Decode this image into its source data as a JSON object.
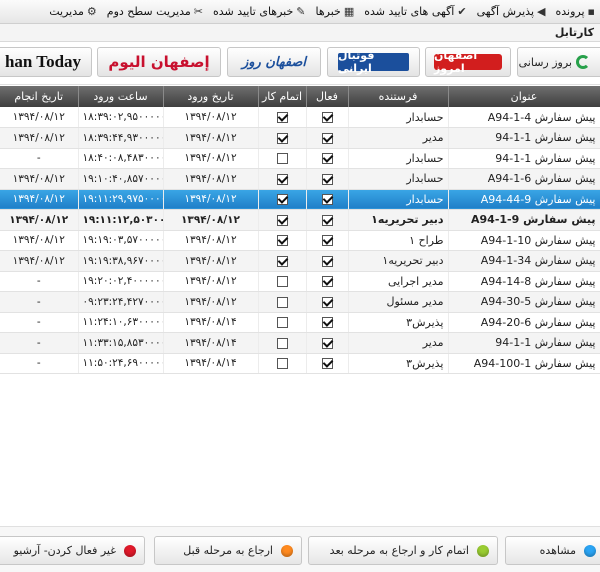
{
  "menu": [
    {
      "label": "پرونده",
      "icon": "folder-icon",
      "glyph": "▪"
    },
    {
      "label": "پذیرش آگهی",
      "icon": "megaphone-icon",
      "glyph": "◀"
    },
    {
      "label": "آگهی های تایید شده",
      "icon": "check-icon",
      "glyph": "✔"
    },
    {
      "label": "خبرها",
      "icon": "news-icon",
      "glyph": "▦"
    },
    {
      "label": "خبرهای تایید شده",
      "icon": "approved-news-icon",
      "glyph": "✎"
    },
    {
      "label": "مدیریت سطح دوم",
      "icon": "tools-icon",
      "glyph": "✂"
    },
    {
      "label": "مدیریت",
      "icon": "gear-icon",
      "glyph": "⚙"
    }
  ],
  "page_title": "کارتابل",
  "toolbar": {
    "refresh_label": "بروز رسانی",
    "logos": [
      {
        "name": "logo-esfahan-emrooz",
        "text": "اصفهان امروز",
        "color": "#d21e1e",
        "bg": "#ffffff"
      },
      {
        "name": "logo-football-irani",
        "text": "فوتبال ایرانی",
        "color": "#ffffff",
        "bg": "#1b4f9c"
      },
      {
        "name": "logo-esfahan-rooz",
        "text": "اصفهان روز",
        "color": "#1b4f9c",
        "bg": "#ffffff"
      },
      {
        "name": "logo-esfahan-alyoum",
        "text": "إصفهان اليوم",
        "color": "#c8102e",
        "bg": "#ffffff"
      },
      {
        "name": "logo-esfahan-today",
        "text": "han Today",
        "color": "#111111",
        "bg": "#ffffff"
      }
    ]
  },
  "table": {
    "columns": [
      "عنوان",
      "فرستنده",
      "فعال",
      "اتمام کار",
      "تاریخ ورود",
      "ساعت ورود",
      "تاریخ انجام"
    ],
    "rows": [
      {
        "title": "پیش سفارش 4-1-A94",
        "sender": "حسابدار",
        "active": true,
        "done": true,
        "date_in": "۱۳۹۴/۰۸/۱۲",
        "time_in": "۱۸:۳۹:۰۲,۹۵۰۰۰۰۰",
        "date_done": "۱۳۹۴/۰۸/۱۲"
      },
      {
        "title": "پیش سفارش 1-1-94",
        "sender": "مدیر",
        "active": true,
        "done": true,
        "date_in": "۱۳۹۴/۰۸/۱۲",
        "time_in": "۱۸:۳۹:۴۴,۹۳۰۰۰۰۰",
        "date_done": "۱۳۹۴/۰۸/۱۲"
      },
      {
        "title": "پیش سفارش 1-1-94",
        "sender": "حسابدار",
        "active": true,
        "done": false,
        "date_in": "۱۳۹۴/۰۸/۱۲",
        "time_in": "۱۸:۴۰:۰۸,۴۸۳۰۰۰۰",
        "date_done": "-"
      },
      {
        "title": "پیش سفارش 6-1-A94",
        "sender": "حسابدار",
        "active": true,
        "done": true,
        "date_in": "۱۳۹۴/۰۸/۱۲",
        "time_in": "۱۹:۱۰:۴۰,۸۵۷۰۰۰۰",
        "date_done": "۱۳۹۴/۰۸/۱۲"
      },
      {
        "title": "پیش سفارش 9-44-A94",
        "sender": "حسابدار",
        "active": true,
        "done": true,
        "date_in": "۱۳۹۴/۰۸/۱۲",
        "time_in": "۱۹:۱۱:۲۹,۹۷۵۰۰۰۰",
        "date_done": "۱۳۹۴/۰۸/۱۲"
      },
      {
        "title": "پیش سفارش 9-1-A94",
        "sender": "دبیر تحریریه۱",
        "active": true,
        "done": true,
        "date_in": "۱۳۹۴/۰۸/۱۲",
        "time_in": "۱۹:۱۱:۱۲,۵۰۳۰۰۰۰",
        "date_done": "۱۳۹۴/۰۸/۱۲"
      },
      {
        "title": "پیش سفارش 10-1-A94",
        "sender": "طراح ۱",
        "active": true,
        "done": true,
        "date_in": "۱۳۹۴/۰۸/۱۲",
        "time_in": "۱۹:۱۹:۰۳,۵۷۰۰۰۰۰",
        "date_done": "۱۳۹۴/۰۸/۱۲"
      },
      {
        "title": "پیش سفارش 34-1-A94",
        "sender": "دبیر تحریریه۱",
        "active": true,
        "done": true,
        "date_in": "۱۳۹۴/۰۸/۱۲",
        "time_in": "۱۹:۱۹:۳۸,۹۶۷۰۰۰۰",
        "date_done": "۱۳۹۴/۰۸/۱۲"
      },
      {
        "title": "پیش سفارش 8-14-A94",
        "sender": "مدیر اجرایی",
        "active": true,
        "done": false,
        "date_in": "۱۳۹۴/۰۸/۱۲",
        "time_in": "۱۹:۲۰:۰۲,۴۰۰۰۰۰۰",
        "date_done": "-"
      },
      {
        "title": "پیش سفارش 5-30-A94",
        "sender": "مدیر مسئول",
        "active": true,
        "done": false,
        "date_in": "۱۳۹۴/۰۸/۱۲",
        "time_in": "۰۹:۲۳:۲۴,۴۲۷۰۰۰۰",
        "date_done": "-"
      },
      {
        "title": "پیش سفارش 6-20-A94",
        "sender": "پذیرش۳",
        "active": true,
        "done": false,
        "date_in": "۱۳۹۴/۰۸/۱۴",
        "time_in": "۱۱:۲۴:۱۰,۶۳۰۰۰۰۰",
        "date_done": "-"
      },
      {
        "title": "پیش سفارش 1-1-94",
        "sender": "مدیر",
        "active": true,
        "done": false,
        "date_in": "۱۳۹۴/۰۸/۱۴",
        "time_in": "۱۱:۳۳:۱۵,۸۵۳۰۰۰۰",
        "date_done": "-"
      },
      {
        "title": "پیش سفارش 1-100-A94",
        "sender": "پذیرش۳",
        "active": true,
        "done": false,
        "date_in": "۱۳۹۴/۰۸/۱۴",
        "time_in": "۱۱:۵۰:۲۴,۶۹۰۰۰۰۰",
        "date_done": "-"
      }
    ],
    "selected_row": 4,
    "bold_row": 5
  },
  "footer": {
    "buttons": [
      {
        "label": "مشاهده",
        "name": "view-button",
        "color": "#2aa4f4"
      },
      {
        "label": "اتمام کار و ارجاع به مرحله بعد",
        "name": "finish-forward-button",
        "color": "#9acd32"
      },
      {
        "label": "ارجاع به مرحله قبل",
        "name": "return-previous-button",
        "color": "#ff8a1f"
      },
      {
        "label": "غیر فعال کردن- آرشیو",
        "name": "deactivate-archive-button",
        "color": "#e0192a"
      }
    ]
  }
}
